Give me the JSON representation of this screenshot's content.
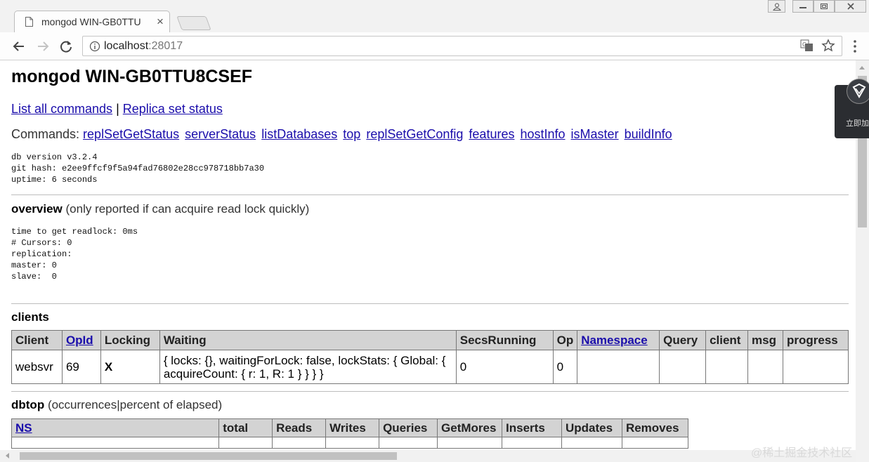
{
  "browser": {
    "tab_title": "mongod WIN-GB0TTU",
    "url_host": "localhost",
    "url_port": ":28017"
  },
  "page": {
    "heading": "mongod WIN-GB0TTU8CSEF",
    "links": {
      "list_commands": "List all commands",
      "separator": "|",
      "replica_status": "Replica set status"
    },
    "commands_label": "Commands:",
    "commands": [
      "replSetGetStatus",
      "serverStatus",
      "listDatabases",
      "top",
      "replSetGetConfig",
      "features",
      "hostInfo",
      "isMaster",
      "buildInfo"
    ],
    "version_block": "db version v3.2.4\ngit hash: e2ee9ffcf9f5a94fad76802e28cc978718bb7a30\nuptime: 6 seconds",
    "overview": {
      "title": "overview",
      "note": "(only reported if can acquire read lock quickly)",
      "details": "time to get readlock: 0ms\n# Cursors: 0\nreplication:\nmaster: 0\nslave:  0"
    },
    "clients": {
      "title": "clients",
      "headers": [
        "Client",
        "OpId",
        "Locking",
        "Waiting",
        "SecsRunning",
        "Op",
        "Namespace",
        "Query",
        "client",
        "msg",
        "progress"
      ],
      "row": [
        "websvr",
        "69",
        "X",
        "{ locks: {}, waitingForLock: false, lockStats: { Global: { acquireCount: { r: 1, R: 1 } } } }",
        "0",
        "0",
        "",
        "",
        "",
        "",
        ""
      ]
    },
    "dbtop": {
      "title": "dbtop",
      "note": "(occurrences|percent of elapsed)",
      "headers": [
        "NS",
        "total",
        "Reads",
        "Writes",
        "Queries",
        "GetMores",
        "Inserts",
        "Updates",
        "Removes"
      ]
    }
  },
  "overlay": {
    "label": "立即加"
  },
  "watermark": "@稀土掘金技术社区"
}
